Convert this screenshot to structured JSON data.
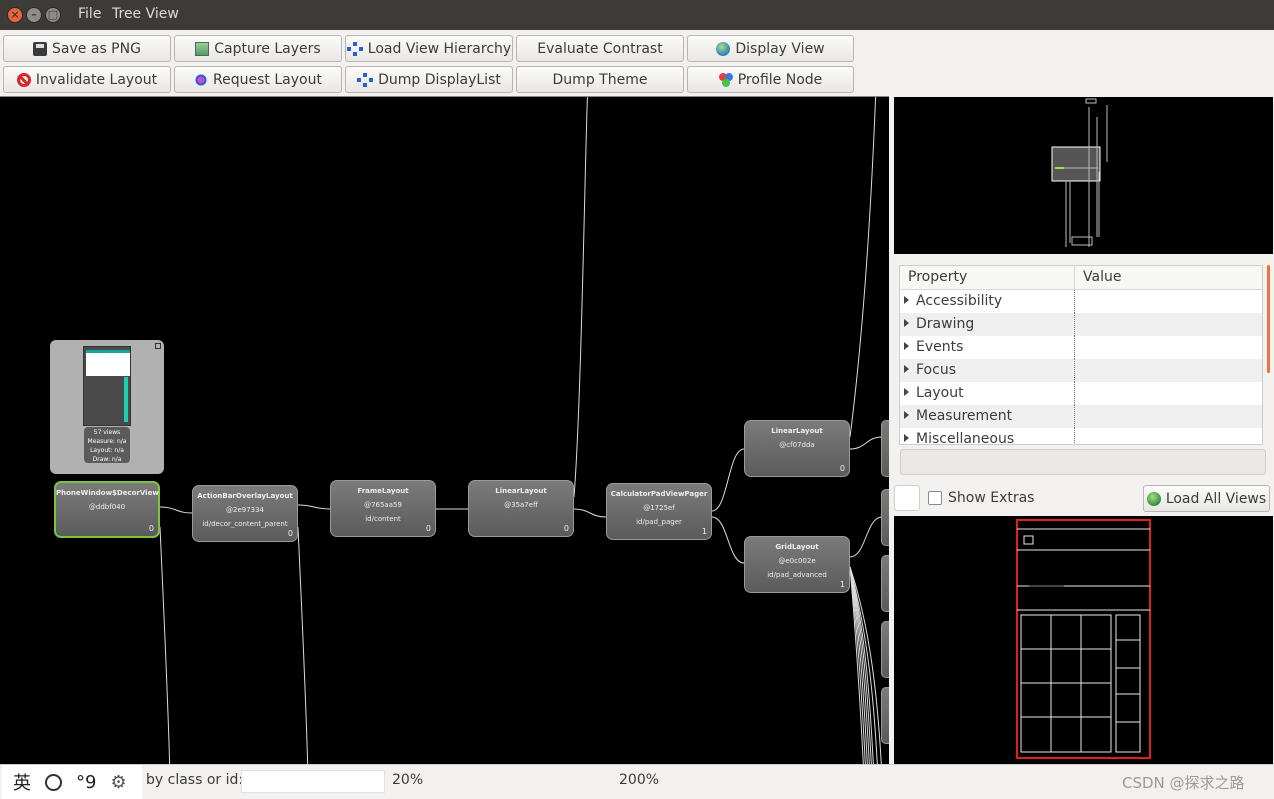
{
  "window": {
    "close_glyph": "×",
    "min_glyph": "–",
    "max_glyph": "□"
  },
  "menu": [
    "File",
    "Tree View"
  ],
  "toolbar": [
    {
      "label": "Save as PNG",
      "icon": "floppy-disk-icon"
    },
    {
      "label": "Capture Layers",
      "icon": "layers-icon"
    },
    {
      "label": "Load View Hierarchy",
      "icon": "hierarchy-icon"
    },
    {
      "label": "Evaluate Contrast"
    },
    {
      "label": "Display View",
      "icon": "globe-icon"
    },
    {
      "label": "Invalidate Layout",
      "icon": "no-entry-icon"
    },
    {
      "label": "Request Layout",
      "icon": "request-icon"
    },
    {
      "label": "Dump DisplayList",
      "icon": "hierarchy-icon"
    },
    {
      "label": "Dump Theme"
    },
    {
      "label": "Profile Node",
      "icon": "profile-icon"
    }
  ],
  "preview": {
    "views": "57 views",
    "measure": "Measure: n/a",
    "layout": "Layout: n/a",
    "draw": "Draw: n/a"
  },
  "nodes": [
    {
      "name": "PhoneWindow$DecorView",
      "hash": "@ddbf040",
      "index": "0"
    },
    {
      "name": "ActionBarOverlayLayout",
      "hash": "@2e97334",
      "id": "id/decor_content_parent",
      "index": "0"
    },
    {
      "name": "FrameLayout",
      "hash": "@765aa59",
      "id": "id/content",
      "index": "0"
    },
    {
      "name": "LinearLayout",
      "hash": "@35a7eff",
      "index": "0"
    },
    {
      "name": "CalculatorPadViewPager",
      "hash": "@1725ef",
      "id": "id/pad_pager",
      "index": "1"
    },
    {
      "name": "LinearLayout",
      "hash": "@cf07dda",
      "index": "0"
    },
    {
      "name": "GridLayout",
      "hash": "@e0c002e",
      "id": "id/pad_advanced",
      "index": "1"
    }
  ],
  "props": {
    "header": [
      "Property",
      "Value"
    ],
    "rows": [
      "Accessibility",
      "Drawing",
      "Events",
      "Focus",
      "Layout",
      "Measurement",
      "Miscellaneous"
    ]
  },
  "extras": {
    "show_extras": "Show Extras",
    "load_all": "Load All Views"
  },
  "ime": {
    "lang": "英",
    "punct": "°9",
    "gear": "⚙"
  },
  "status": {
    "filter_label": "by class or id:",
    "filter_value": "",
    "zoom_min": "20%",
    "zoom_max": "200%",
    "watermark": "CSDN @探求之路"
  },
  "colors": {
    "selected_node_border": "#7cc43c",
    "canvas_bg": "#000000",
    "layout_frame": "#e02020",
    "scroll_accent": "#e8743a"
  }
}
